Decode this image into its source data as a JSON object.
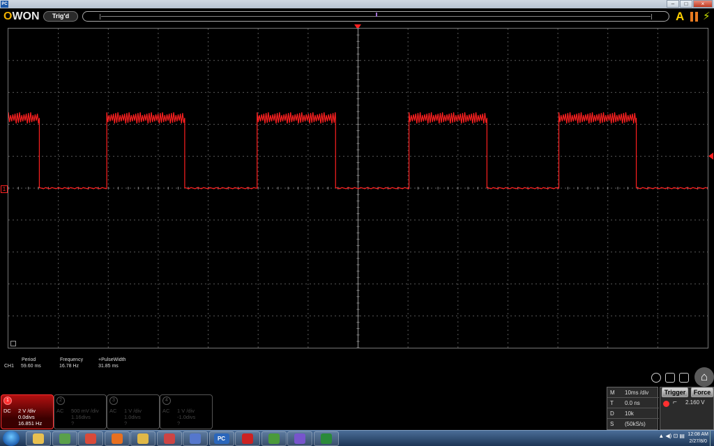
{
  "window": {
    "app_icon_label": "PC",
    "controls": [
      "–",
      "□",
      "×"
    ]
  },
  "header": {
    "logo_text_left": "O",
    "logo_text_right": "WON",
    "trigger_status": "Trig'd"
  },
  "measurements": {
    "channel": "CH1",
    "items": [
      {
        "label": "Period",
        "value": "59.60 ms"
      },
      {
        "label": "Frequency",
        "value": "16.78 Hz"
      },
      {
        "label": "+PulseWidth",
        "value": "31.85 ms"
      }
    ]
  },
  "channels": [
    {
      "number": "1",
      "coupling": "DC",
      "scale": "2 V /div",
      "offset": "0.0divs",
      "freq": "16.851 Hz",
      "active": true
    },
    {
      "number": "2",
      "coupling": "AC",
      "scale": "500 mV /div",
      "offset": "1.16divs",
      "freq": "?",
      "active": false
    },
    {
      "number": "3",
      "coupling": "AC",
      "scale": "1 V /div",
      "offset": "1.0divs",
      "freq": "?",
      "active": false
    },
    {
      "number": "4",
      "coupling": "AC",
      "scale": "1 V /div",
      "offset": "-1.0divs",
      "freq": "?",
      "active": false
    }
  ],
  "timebase": {
    "rows": [
      {
        "key": "M",
        "value": "10ms /div"
      },
      {
        "key": "T",
        "value": "0.0 ns"
      },
      {
        "key": "D",
        "value": "10k"
      },
      {
        "key": "S",
        "value": "(50kS/s)"
      }
    ]
  },
  "trigger": {
    "trigger_button": "Trigger",
    "force_button": "Force",
    "level": "2.160 V",
    "edge_icon": "rising-edge-icon"
  },
  "taskbar": {
    "pinned": [
      {
        "name": "explorer-icon",
        "color": "#e8c050"
      },
      {
        "name": "app-icon",
        "color": "#5aa04a"
      },
      {
        "name": "chrome-icon",
        "color": "#d94a3a"
      },
      {
        "name": "firefox-icon",
        "color": "#e87020"
      },
      {
        "name": "folder-icon",
        "color": "#e0b848"
      },
      {
        "name": "media-icon",
        "color": "#cc4444"
      },
      {
        "name": "library-icon",
        "color": "#5577cc"
      },
      {
        "name": "pc-icon",
        "color": "#2a66bb",
        "label": "PC"
      },
      {
        "name": "pdf-icon",
        "color": "#cc2222"
      },
      {
        "name": "avr-icon",
        "color": "#4a9a3a"
      },
      {
        "name": "paint-icon",
        "color": "#7755cc"
      },
      {
        "name": "excel-icon",
        "color": "#2a8a3a"
      }
    ],
    "clock_time": "12:08 AM",
    "clock_date": "2/27/8/0"
  },
  "colors": {
    "trace": "#ff2020",
    "grid": "#5a5a5a",
    "active_channel": "#ff3030",
    "logo_accent": "#f0b000"
  },
  "chart_data": {
    "type": "line",
    "title": "",
    "xlabel": "",
    "ylabel": "",
    "x_divisions": 14,
    "y_divisions": 10,
    "x_unit": "ms",
    "x_per_div": 10,
    "y_per_div": 2,
    "series": [
      {
        "x": [
          -70,
          -63.8,
          -63.8,
          -50.3,
          -50.3,
          -34.7,
          -34.7,
          -20.2,
          -20.2,
          -4.5,
          -4.5,
          10.2,
          10.2,
          25.8,
          25.8,
          40.2,
          40.2,
          55.7,
          55.7,
          70
        ],
        "y": [
          4.4,
          4.4,
          0,
          0,
          4.4,
          4.4,
          0,
          0,
          4.4,
          4.4,
          0,
          0,
          4.4,
          4.4,
          0,
          0,
          4.4,
          4.4,
          0,
          0
        ]
      }
    ]
  }
}
